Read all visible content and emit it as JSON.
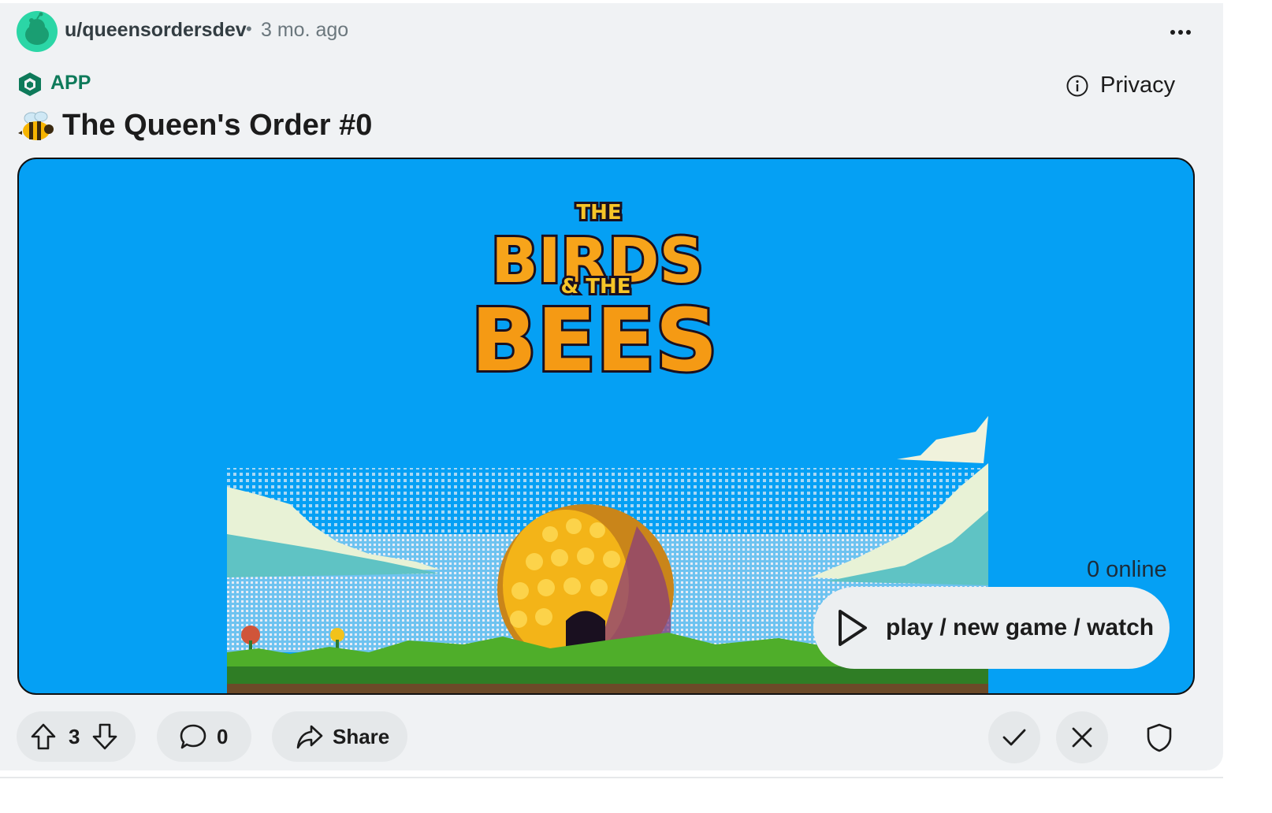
{
  "post": {
    "author": "u/queensordersdev",
    "separator": "•",
    "time": "3 mo. ago",
    "app_label": "APP",
    "privacy_label": "Privacy",
    "title": "The Queen's Order #0",
    "title_emoji": "bee-emoji"
  },
  "game": {
    "logo_line1": "THE",
    "logo_line2": "BIRDS",
    "logo_line3": "& THE",
    "logo_line4": "BEES",
    "online_text": "0 online",
    "play_label": "play / new game / watch"
  },
  "actions": {
    "vote_count": "3",
    "comment_count": "0",
    "share_label": "Share"
  },
  "icons": {
    "upvote": "arrow-up-icon",
    "downvote": "arrow-down-icon",
    "comment": "speech-bubble-icon",
    "share": "share-arrow-icon",
    "approve": "checkmark-icon",
    "remove": "close-icon",
    "mod": "shield-icon",
    "more": "more-options-icon",
    "info": "info-icon",
    "app": "hexagon-app-icon",
    "play": "play-icon"
  },
  "colors": {
    "background": "#f0f2f4",
    "game_background": "#05a0f4",
    "app_green": "#0e7a5a",
    "avatar": "#2bd6a6",
    "button": "#e5e8ea"
  }
}
